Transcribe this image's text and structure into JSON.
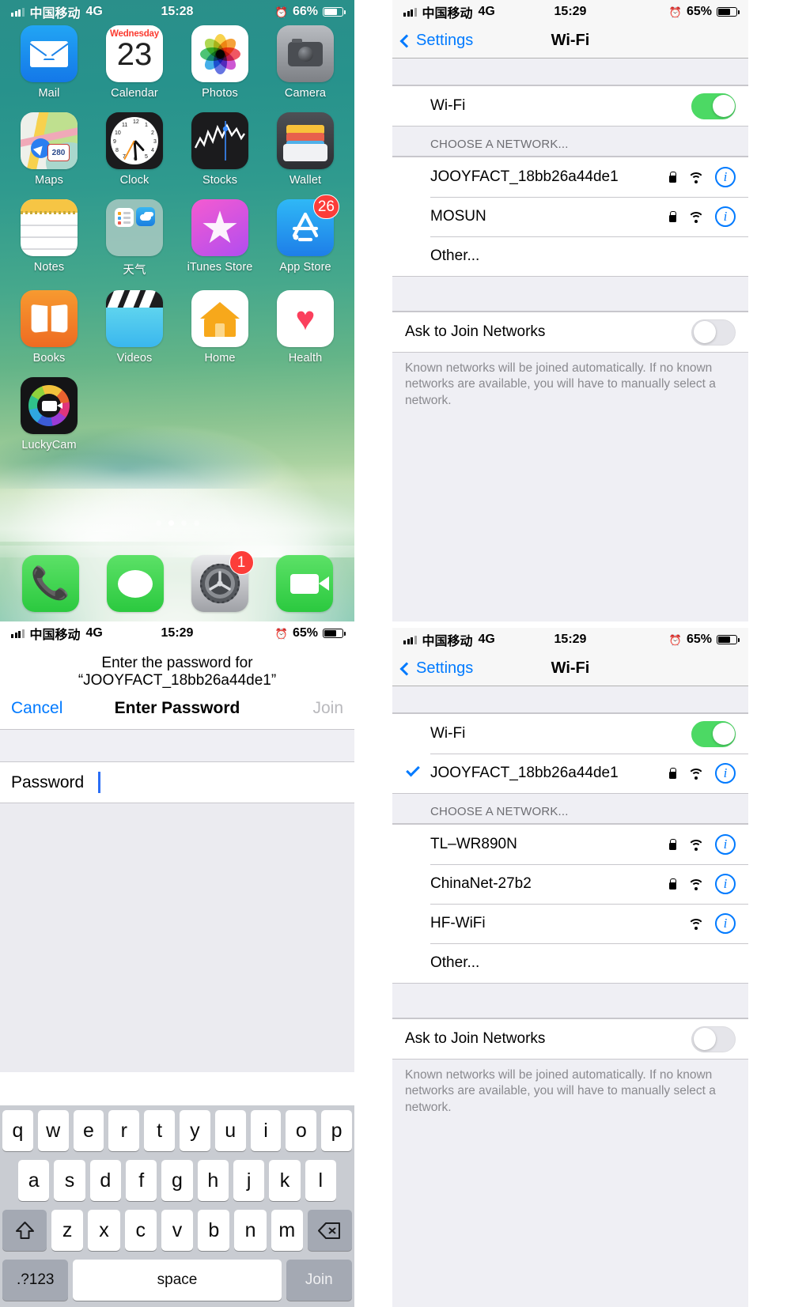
{
  "home": {
    "statusbar": {
      "carrier": "中国移动",
      "network": "4G",
      "time": "15:28",
      "battery": "66%"
    },
    "apps": [
      {
        "name": "Mail",
        "icon": "mail-icon"
      },
      {
        "name": "Calendar",
        "icon": "calendar-icon",
        "weekday": "Wednesday",
        "date": "23"
      },
      {
        "name": "Photos",
        "icon": "photos-icon"
      },
      {
        "name": "Camera",
        "icon": "camera-icon"
      },
      {
        "name": "Maps",
        "icon": "maps-icon",
        "shield": "280"
      },
      {
        "name": "Clock",
        "icon": "clock-icon"
      },
      {
        "name": "Stocks",
        "icon": "stocks-icon"
      },
      {
        "name": "Wallet",
        "icon": "wallet-icon"
      },
      {
        "name": "Notes",
        "icon": "notes-icon"
      },
      {
        "name": "天气",
        "icon": "folder-icon"
      },
      {
        "name": "iTunes Store",
        "icon": "itunes-store-icon"
      },
      {
        "name": "App Store",
        "icon": "app-store-icon",
        "badge": "26"
      },
      {
        "name": "Books",
        "icon": "books-icon"
      },
      {
        "name": "Videos",
        "icon": "videos-icon"
      },
      {
        "name": "Home",
        "icon": "home-icon"
      },
      {
        "name": "Health",
        "icon": "health-icon"
      },
      {
        "name": "LuckyCam",
        "icon": "luckycam-icon"
      }
    ],
    "dock": [
      {
        "name": "Phone",
        "icon": "phone-icon"
      },
      {
        "name": "Messages",
        "icon": "messages-icon"
      },
      {
        "name": "Settings",
        "icon": "settings-gear-icon",
        "badge": "1"
      },
      {
        "name": "FaceTime",
        "icon": "facetime-icon"
      }
    ],
    "page_dots": {
      "count": 4,
      "active_index": 1
    }
  },
  "wifi_before": {
    "statusbar": {
      "carrier": "中国移动",
      "network": "4G",
      "time": "15:29",
      "battery": "65%"
    },
    "nav": {
      "back": "Settings",
      "title": "Wi-Fi"
    },
    "wifi_row": {
      "label": "Wi-Fi",
      "toggle_on": true
    },
    "section_header": "CHOOSE A NETWORK...",
    "networks": [
      {
        "ssid": "JOOYFACT_18bb26a44de1",
        "secured": true,
        "connected": false
      },
      {
        "ssid": "MOSUN",
        "secured": true,
        "connected": false
      }
    ],
    "other": "Other...",
    "ask_row": {
      "label": "Ask to Join Networks",
      "toggle_on": false
    },
    "footnote": "Known networks will be joined automatically. If no known networks are available, you will have to manually select a network."
  },
  "wifi_after": {
    "statusbar": {
      "carrier": "中国移动",
      "network": "4G",
      "time": "15:29",
      "battery": "65%"
    },
    "nav": {
      "back": "Settings",
      "title": "Wi-Fi"
    },
    "wifi_row": {
      "label": "Wi-Fi",
      "toggle_on": true
    },
    "connected": {
      "ssid": "JOOYFACT_18bb26a44de1",
      "secured": true,
      "connected": true
    },
    "section_header": "CHOOSE A NETWORK...",
    "networks": [
      {
        "ssid": "TL–WR890N",
        "secured": true,
        "connected": false
      },
      {
        "ssid": "ChinaNet-27b2",
        "secured": true,
        "connected": false
      },
      {
        "ssid": "HF-WiFi",
        "secured": false,
        "connected": false
      }
    ],
    "other": "Other...",
    "ask_row": {
      "label": "Ask to Join Networks",
      "toggle_on": false
    },
    "footnote": "Known networks will be joined automatically. If no known networks are available, you will have to manually select a network."
  },
  "password_sheet": {
    "statusbar": {
      "carrier": "中国移动",
      "network": "4G",
      "time": "15:29",
      "battery": "65%"
    },
    "prompt": "Enter the password for “JOOYFACT_18bb26a44de1”",
    "cancel": "Cancel",
    "title": "Enter Password",
    "join": "Join",
    "field_label": "Password",
    "field_value": "",
    "keyboard": {
      "row1": [
        "q",
        "w",
        "e",
        "r",
        "t",
        "y",
        "u",
        "i",
        "o",
        "p"
      ],
      "row2": [
        "a",
        "s",
        "d",
        "f",
        "g",
        "h",
        "j",
        "k",
        "l"
      ],
      "row3": [
        "z",
        "x",
        "c",
        "v",
        "b",
        "n",
        "m"
      ],
      "shift": "shift-icon",
      "delete": "delete-icon",
      "numbers": ".?123",
      "space": "space",
      "return": "Join"
    }
  },
  "colors": {
    "ios_blue": "#007aff",
    "toggle_green": "#4cd964",
    "badge_red": "#fc3d39",
    "group_bg": "#ffffff",
    "page_bg": "#efeff4"
  }
}
